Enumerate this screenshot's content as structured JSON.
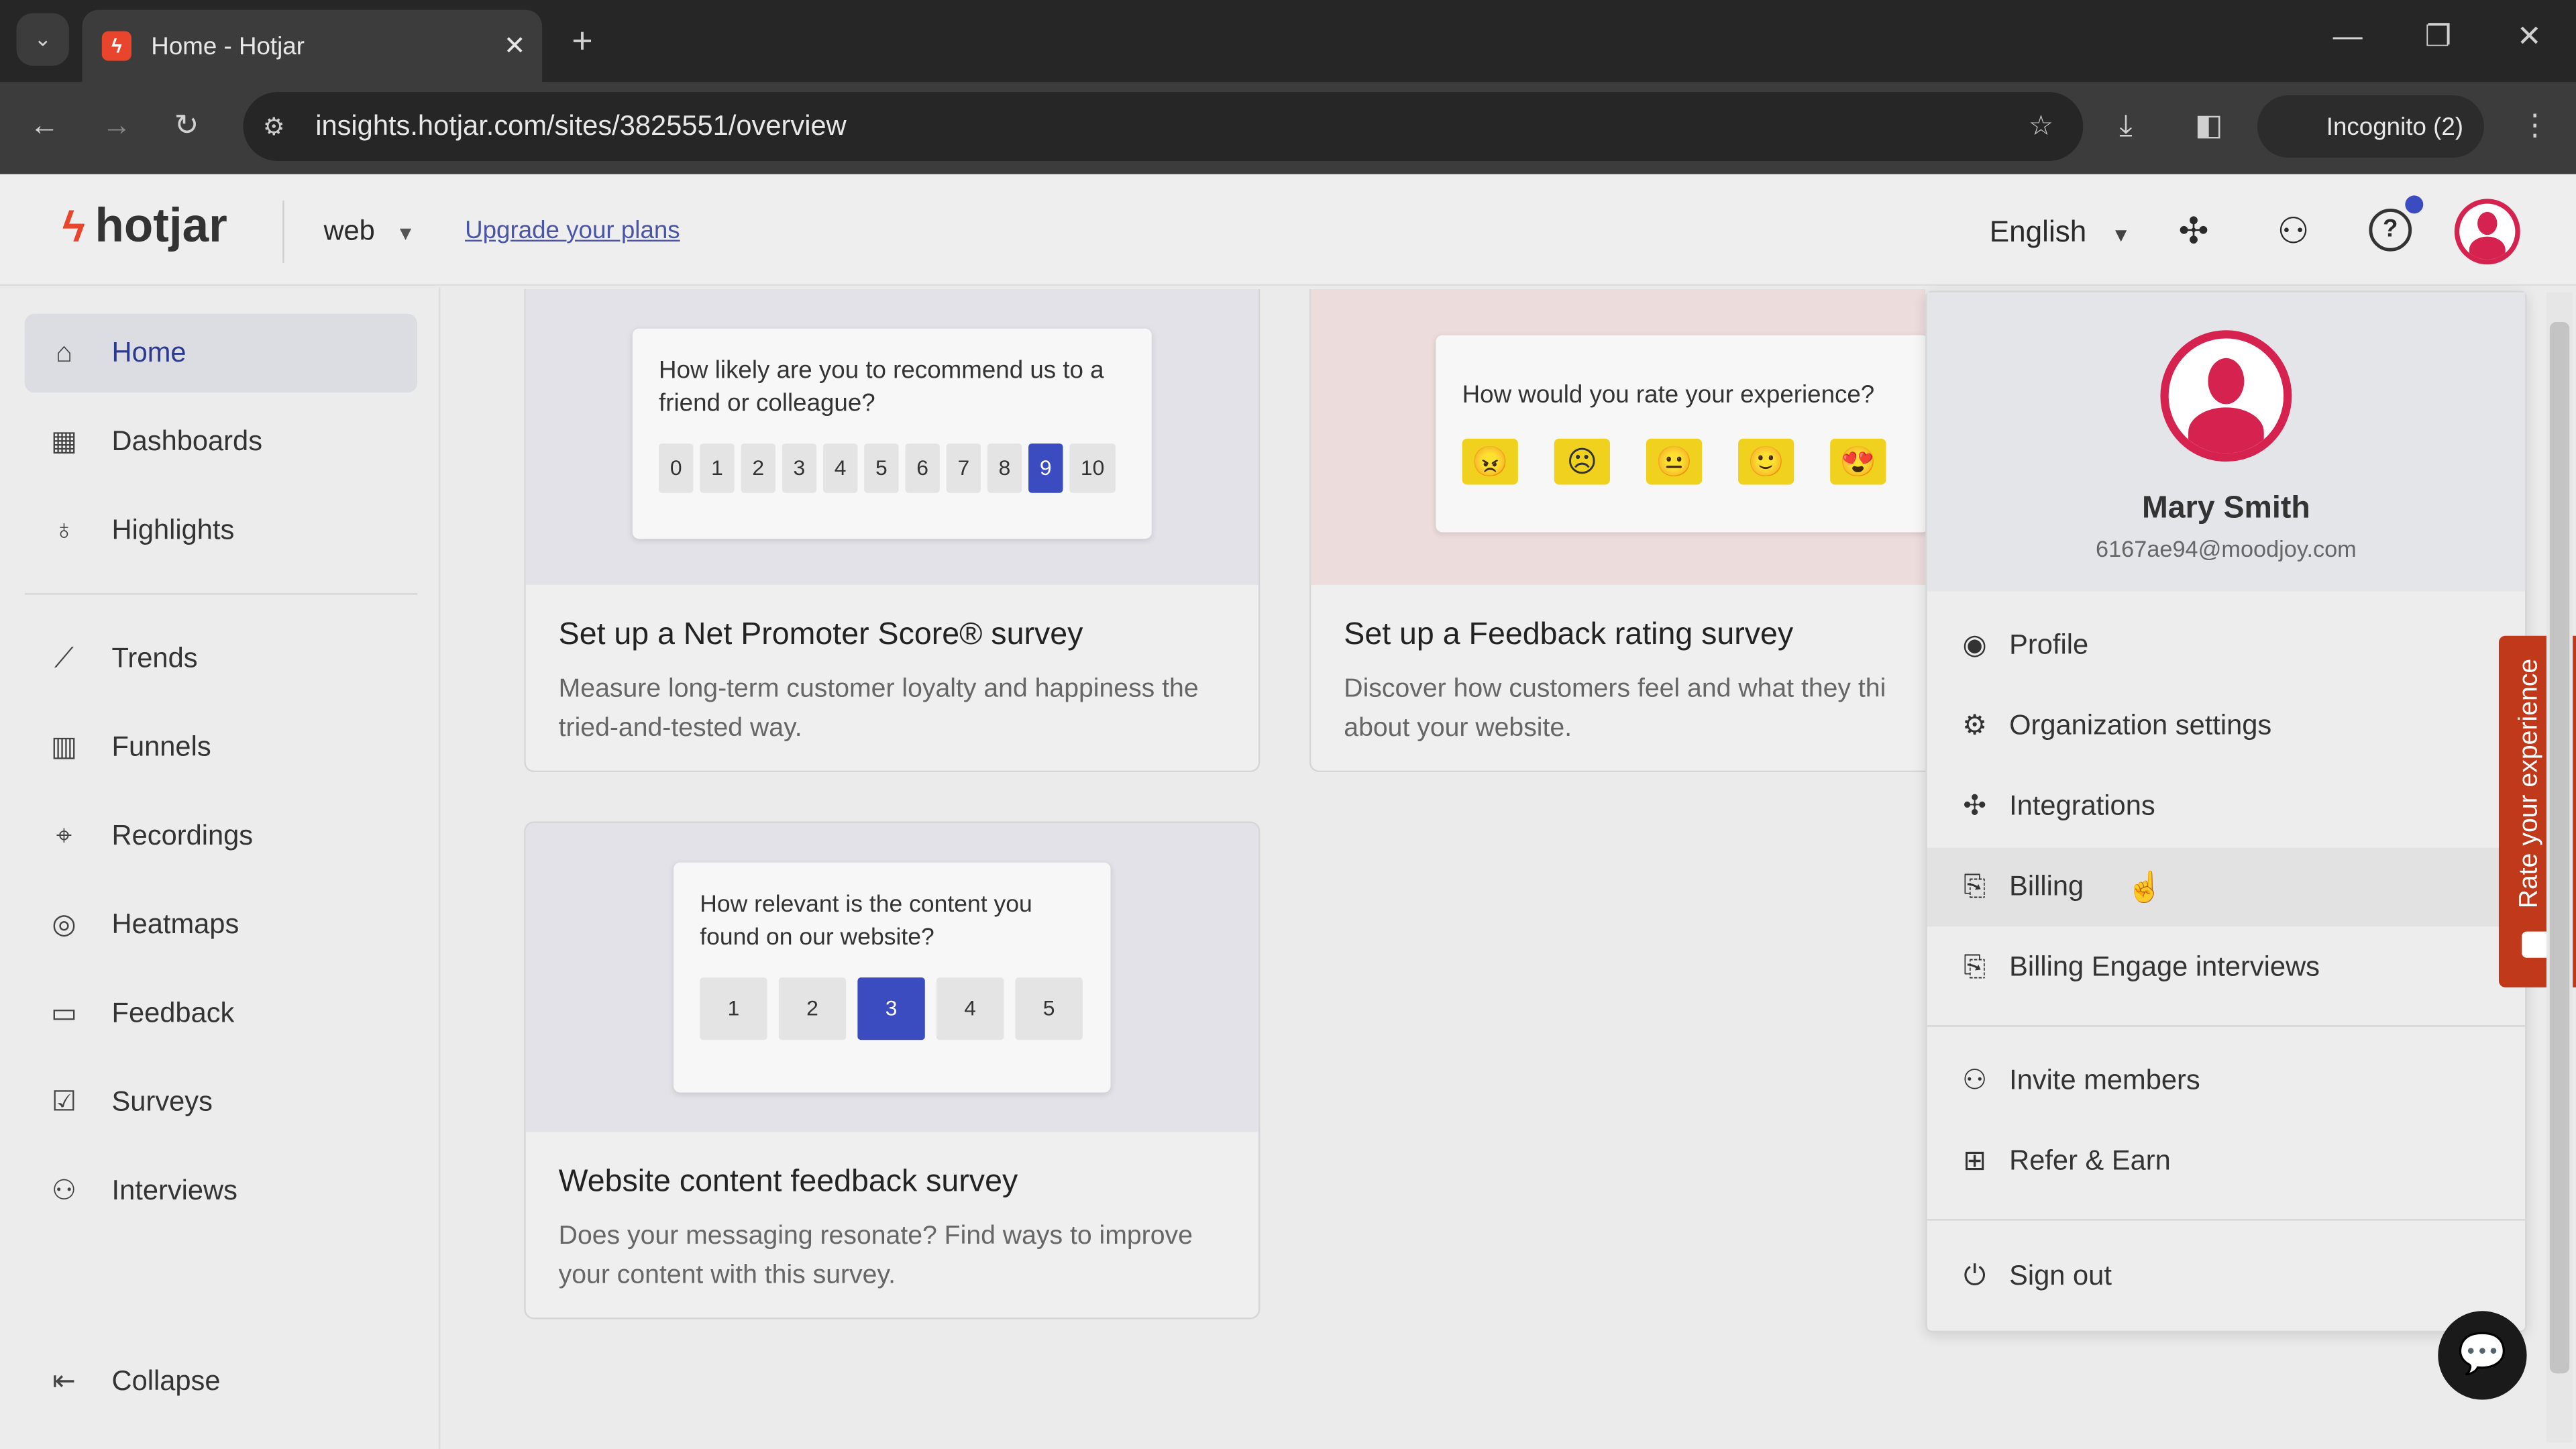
{
  "browser": {
    "tab_title": "Home - Hotjar",
    "url": "insights.hotjar.com/sites/3825551/overview",
    "incognito": "Incognito (2)"
  },
  "header": {
    "logo": "hotjar",
    "site": "web",
    "upgrade": "Upgrade your plans",
    "language": "English"
  },
  "sidebar": {
    "items": [
      {
        "label": "Home",
        "icon": "home-icon"
      },
      {
        "label": "Dashboards",
        "icon": "dashboard-icon"
      },
      {
        "label": "Highlights",
        "icon": "lightbulb-icon"
      },
      {
        "label": "Trends",
        "icon": "trend-icon"
      },
      {
        "label": "Funnels",
        "icon": "funnel-icon"
      },
      {
        "label": "Recordings",
        "icon": "recording-icon"
      },
      {
        "label": "Heatmaps",
        "icon": "heatmap-icon"
      },
      {
        "label": "Feedback",
        "icon": "feedback-icon"
      },
      {
        "label": "Surveys",
        "icon": "survey-icon"
      },
      {
        "label": "Interviews",
        "icon": "interviews-icon"
      }
    ],
    "collapse": "Collapse"
  },
  "cards": [
    {
      "question": "How likely are you to recommend us to a friend or colleague?",
      "scale": [
        "0",
        "1",
        "2",
        "3",
        "4",
        "5",
        "6",
        "7",
        "8",
        "9",
        "10"
      ],
      "selected": "9",
      "title": "Set up a Net Promoter Score® survey",
      "desc": "Measure long-term customer loyalty and happiness the tried-and-tested way."
    },
    {
      "question": "How would you rate your experience?",
      "title": "Set up a Feedback rating survey",
      "desc": "Discover how customers feel and what they thi about your website."
    },
    {
      "question": "How relevant is the content you found on our website?",
      "scale": [
        "1",
        "2",
        "3",
        "4",
        "5"
      ],
      "selected": "3",
      "title": "Website content feedback survey",
      "desc": "Does your messaging resonate? Find ways to improve your content with this survey."
    }
  ],
  "user_menu": {
    "name": "Mary Smith",
    "email": "6167ae94@moodjoy.com",
    "items": [
      {
        "label": "Profile",
        "icon": "profile-icon"
      },
      {
        "label": "Organization settings",
        "icon": "gear-icon"
      },
      {
        "label": "Integrations",
        "icon": "puzzle-icon"
      },
      {
        "label": "Billing",
        "icon": "billing-icon"
      },
      {
        "label": "Billing Engage interviews",
        "icon": "billing-icon"
      },
      {
        "label": "Invite members",
        "icon": "add-user-icon"
      },
      {
        "label": "Refer & Earn",
        "icon": "gift-icon"
      },
      {
        "label": "Sign out",
        "icon": "power-icon"
      }
    ]
  },
  "feedback_tab": "Rate your experience",
  "colors": {
    "accent": "#3b4cc0",
    "brand": "#e8452c",
    "avatar": "#d6224e",
    "feedback_tab": "#c0391b"
  }
}
